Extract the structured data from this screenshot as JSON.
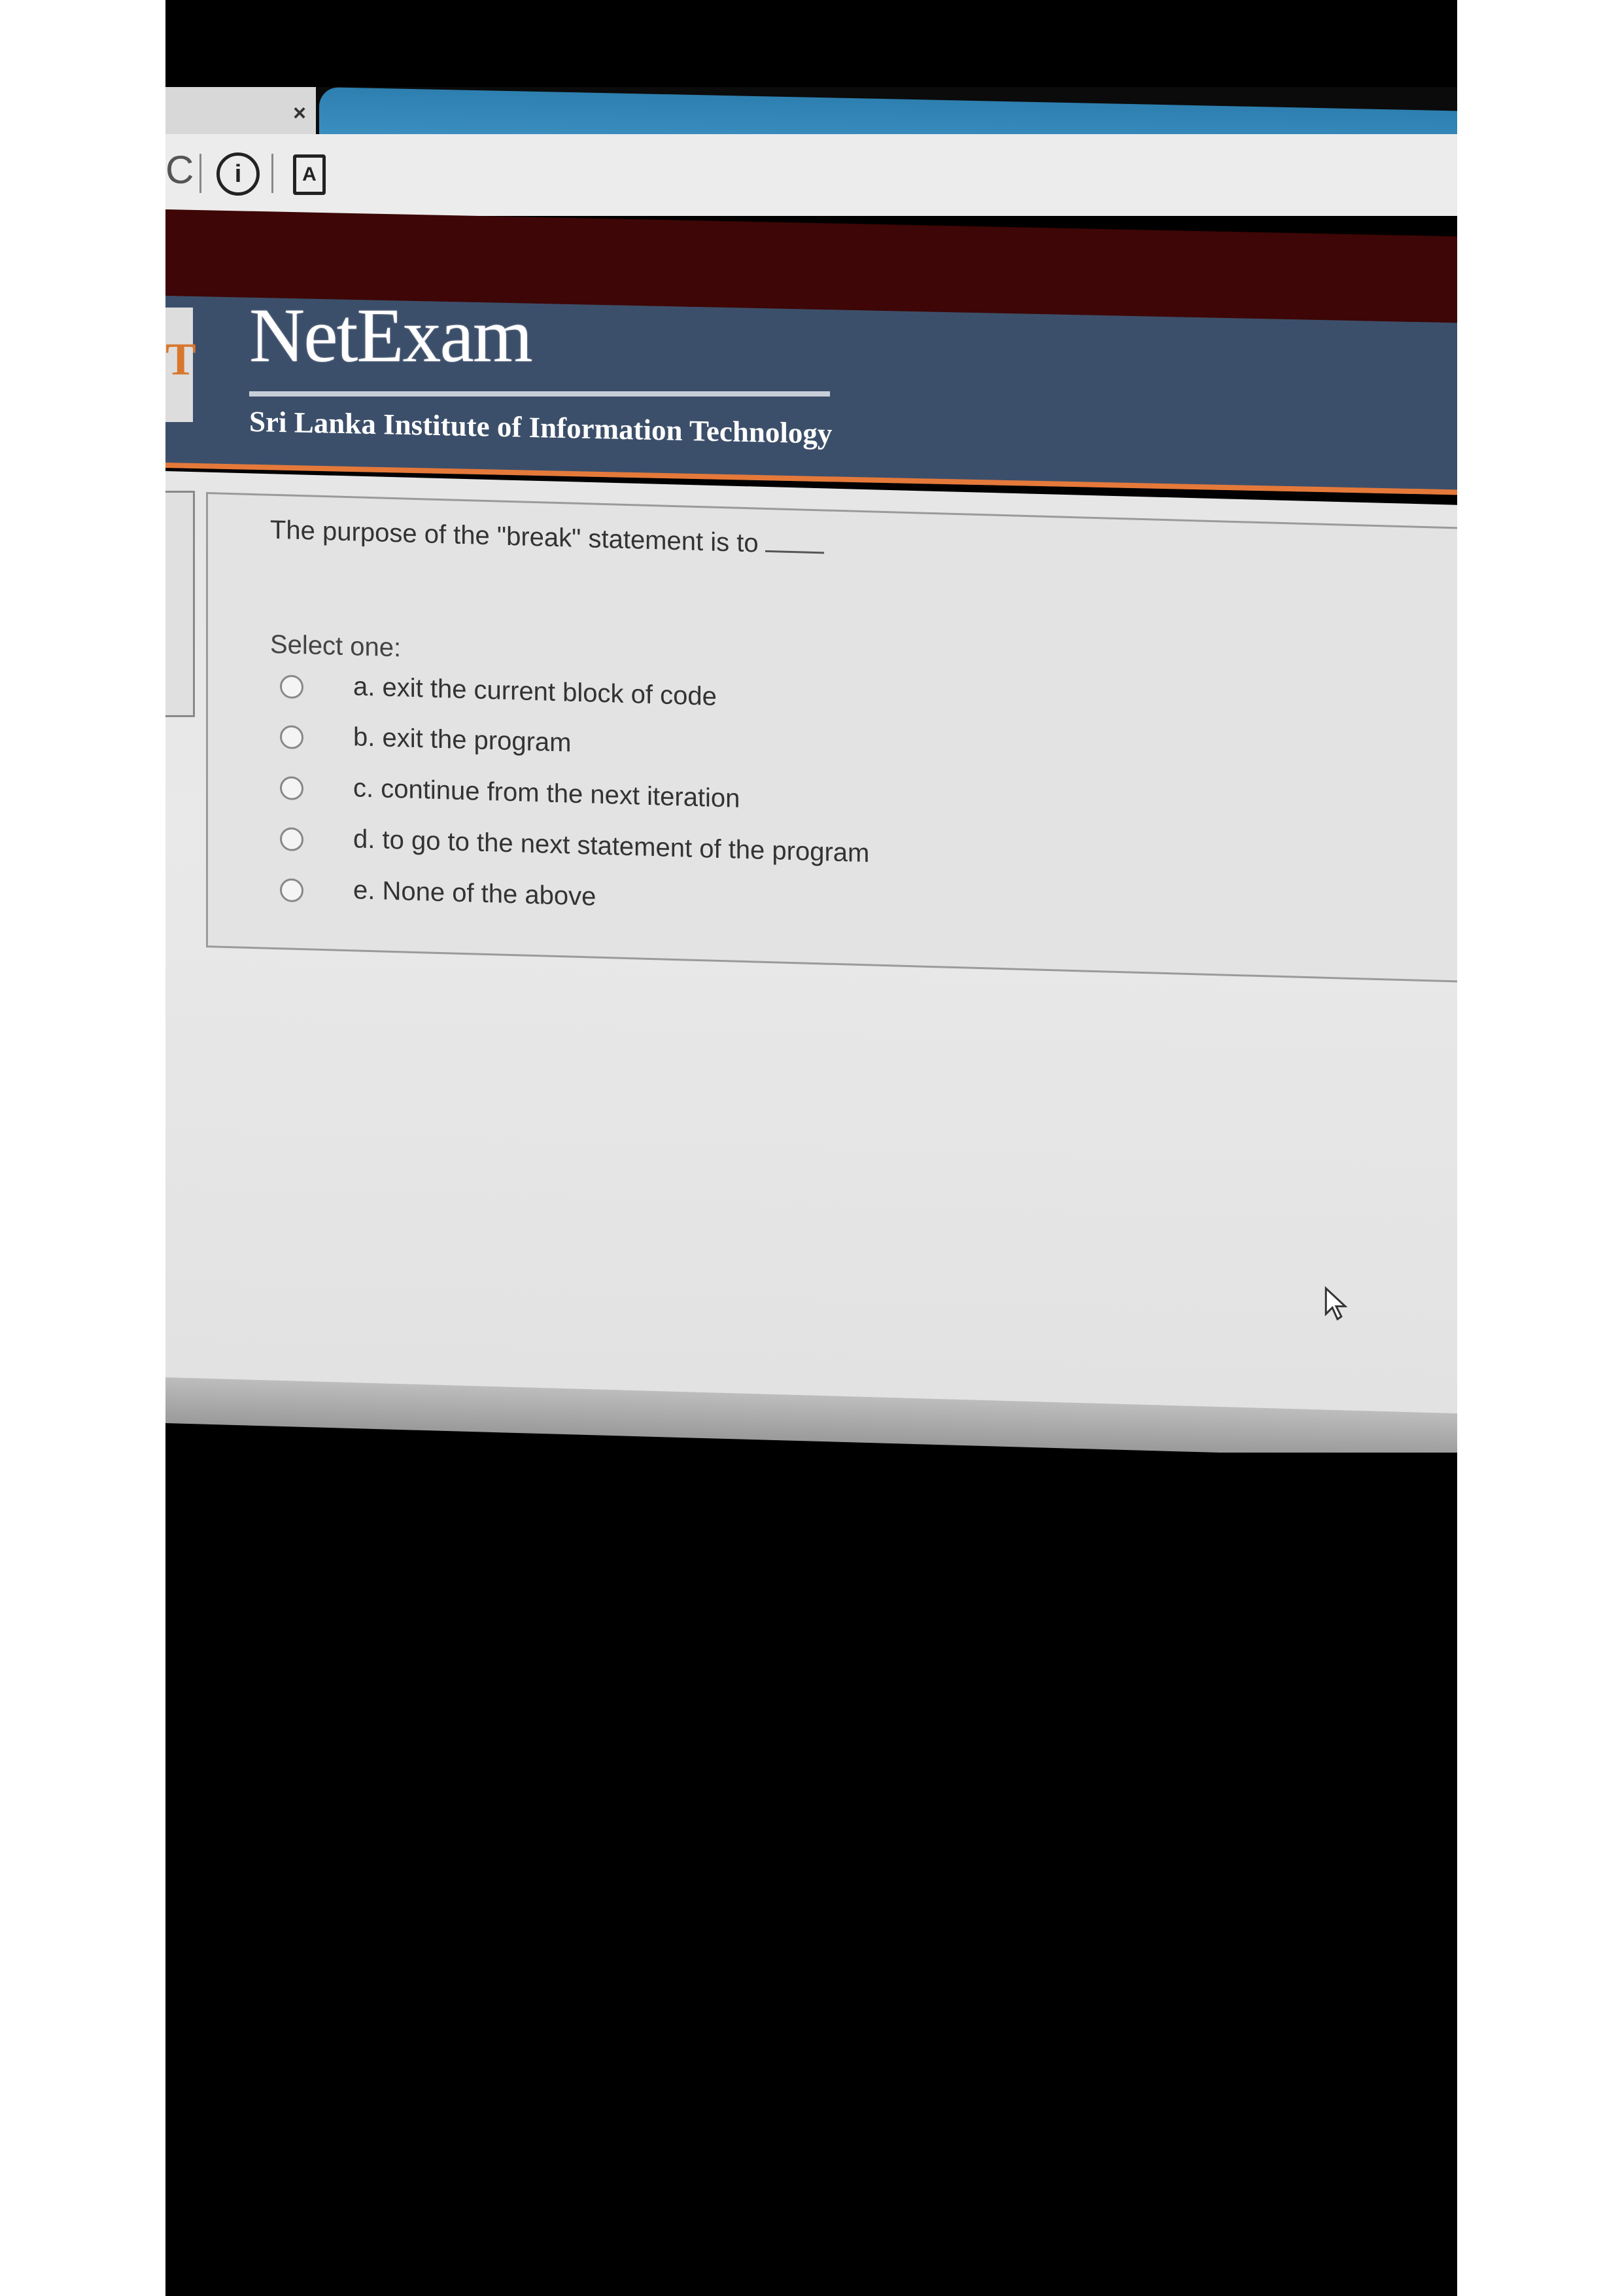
{
  "browser": {
    "tab_close": "×",
    "info_icon": "i",
    "pdf_icon": "A",
    "reload_icon": "C"
  },
  "header": {
    "logo_letter": "T",
    "title": "NetExam",
    "subtitle": "Sri Lanka Institute of Information Technology"
  },
  "question": {
    "text": "The purpose of the \"break\" statement is to",
    "select_label": "Select one:",
    "options": [
      {
        "label": "a. exit the current block of code"
      },
      {
        "label": "b. exit the program"
      },
      {
        "label": "c. continue from the next iteration"
      },
      {
        "label": "d. to go to the next statement of the program"
      },
      {
        "label": "e. None of the above"
      }
    ]
  },
  "colors": {
    "header_bg": "#3c4f6a",
    "maroon_bar": "#3e0606",
    "accent_orange": "#e5793a",
    "tab_blue": "#3a8dbd"
  }
}
